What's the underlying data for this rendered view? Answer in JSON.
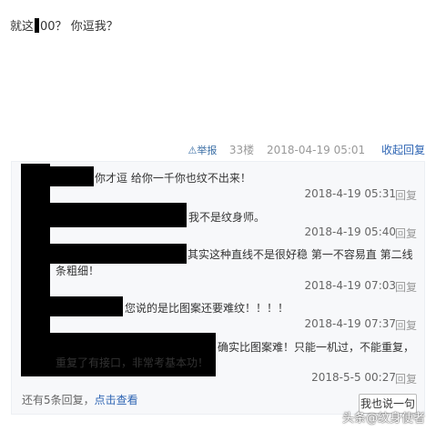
{
  "post": {
    "text_before": "就这",
    "text_after": "00？ 你逗我？"
  },
  "meta": {
    "report_icon": "warning-triangle-icon",
    "report_label": "举报",
    "floor": "33楼",
    "time": "2018-04-19 05:01",
    "collapse_label": "收起回复"
  },
  "replies": [
    {
      "text": "你才逗 给你一千你也纹不出来！",
      "text2": "",
      "time": "2018-4-19 05:31",
      "reply_label": "回复"
    },
    {
      "text": "我不是纹身师。",
      "text2": "",
      "time": "2018-4-19 05:40",
      "reply_label": "回复"
    },
    {
      "text": "其实这种直线不是很好稳 第一不容易直 第二线",
      "text2": "条粗细！",
      "time": "2018-4-19 07:03",
      "reply_label": "回复"
    },
    {
      "text": "您说的是比图案还要难纹！！！！",
      "text2": "",
      "time": "2018-4-19 07:37",
      "reply_label": "回复"
    },
    {
      "text": "确实比图案难！只能一机过，不能重复，",
      "text2": "重复了有接口，非常考基本功！",
      "time": "2018-5-5 00:27",
      "reply_label": "回复"
    }
  ],
  "footer": {
    "more_text": "还有5条回复，",
    "more_link": "点击查看",
    "say_button": "我也说一句"
  },
  "watermark": "头条@纹身使者"
}
